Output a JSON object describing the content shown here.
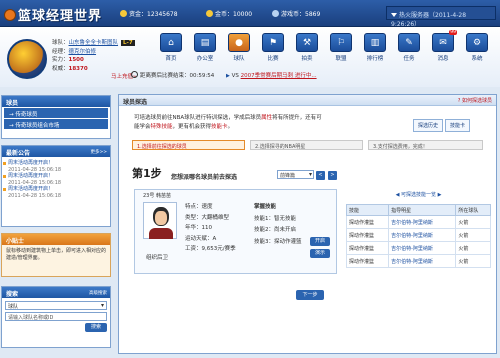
{
  "header": {
    "logo": "篮球经理世界",
    "assets_label": "资金：",
    "assets_value": "12345678",
    "coins_label": "金币：",
    "coins_value": "10000",
    "points_label": "游戏币：",
    "points_value": "5869",
    "server": "热火服务器（2011-4-28  9:26:26）"
  },
  "club": {
    "name_label": "球队：",
    "name": "山东鲁全全卡斯图队",
    "level": "L-7",
    "owner_label": "经理：",
    "owner": "德克尔伯修",
    "strength_label": "实力：",
    "strength": "1500",
    "rank_label": "权威：",
    "rank": "18370",
    "upgrade": "马上充值»"
  },
  "nav": [
    {
      "label": "首页",
      "icon": "home-icon"
    },
    {
      "label": "办公室",
      "icon": "office-icon"
    },
    {
      "label": "球队",
      "icon": "basketball-icon"
    },
    {
      "label": "比赛",
      "icon": "match-icon"
    },
    {
      "label": "拍卖",
      "icon": "auction-icon"
    },
    {
      "label": "联盟",
      "icon": "league-icon"
    },
    {
      "label": "排行榜",
      "icon": "ranking-icon"
    },
    {
      "label": "任务",
      "icon": "task-icon"
    },
    {
      "label": "消息",
      "icon": "message-icon",
      "badge": "99"
    },
    {
      "label": "系统",
      "icon": "system-icon"
    }
  ],
  "ticker": {
    "prefix": "距离赛后比赛结束：",
    "time": "00:59:54",
    "vs": "VS",
    "text": "2007季常赛后期马刺 进行中...",
    "arrow": "▶"
  },
  "sidebar": {
    "team_title": "球员",
    "team_links": [
      "→ 传奇球员",
      "→ 传奇球员组合市场"
    ],
    "news_title": "最新公告",
    "news_more": "更多>>",
    "news": [
      {
        "title": "周末活动再度开启！",
        "date": "2011-04-28  15:06:18"
      },
      {
        "title": "周末活动再度开启！",
        "date": "2011-04-28  15:06:18"
      },
      {
        "title": "周末活动再度开启！",
        "date": "2011-04-28  15:06:18"
      }
    ],
    "tips_title": "小贴士",
    "tips_text": "鼠标移动到建筑物上单击，即可进入相对应的建造/管理界面。",
    "search_title": "搜索",
    "search_more": "高级搜索",
    "search_select": "球队",
    "search_placeholder": "请输入球队名称或ID",
    "search_button": "搜索"
  },
  "main": {
    "title": "球员探选",
    "help": "如何探选球员",
    "intro1": "可培选球员前往NBA球队进行特训探选，学成后球员",
    "intro_highlight": "属性",
    "intro2": "将有所提升，还有可",
    "intro3": "能学会",
    "intro_skill": "特殊技能",
    "intro4": "，更有机会获得",
    "intro_card": "技能卡",
    "intro5": "。",
    "tab1": "探选历史",
    "tab2": "技能卡",
    "steps": [
      "1.选择前往探选的球员",
      "2.选择探寻的NBA明星",
      "3.支付探选费用，完成！"
    ],
    "step_heading": "第1步",
    "step_question": "您想派哪名球员前去探选",
    "position_select": "前锋篇",
    "prev": "<",
    "next_page": ">",
    "player": {
      "number": "23号 韩苗苗",
      "name": "组织后卫",
      "trait": "特点：速度",
      "type": "类型：大翻桶维型",
      "age": "年华：110",
      "stamina": "运动天赋：A",
      "salary": "工资：9,653元/赛季"
    },
    "skills": {
      "header": "掌握技能",
      "skill1": "技能1：智无技能",
      "skill2": "技能2：尚未开启",
      "skill3": "技能3：探动作灌篮",
      "open_btn": "开启",
      "play_btn": "演示"
    },
    "right_table": {
      "caption": "◀  可探选技能一览  ▶",
      "headers": [
        "技能",
        "指导明星",
        "所在球队"
      ],
      "rows": [
        [
          "探动作灌篮",
          "吉尔伯特-阿里纳斯",
          "火箭"
        ],
        [
          "探动作灌篮",
          "吉尔伯特-阿里纳斯",
          "火箭"
        ],
        [
          "探动作灌篮",
          "吉尔伯特-阿里纳斯",
          "火箭"
        ],
        [
          "探动作灌篮",
          "吉尔伯特-阿里纳斯",
          "火箭"
        ]
      ]
    },
    "next_button": "下一步"
  }
}
